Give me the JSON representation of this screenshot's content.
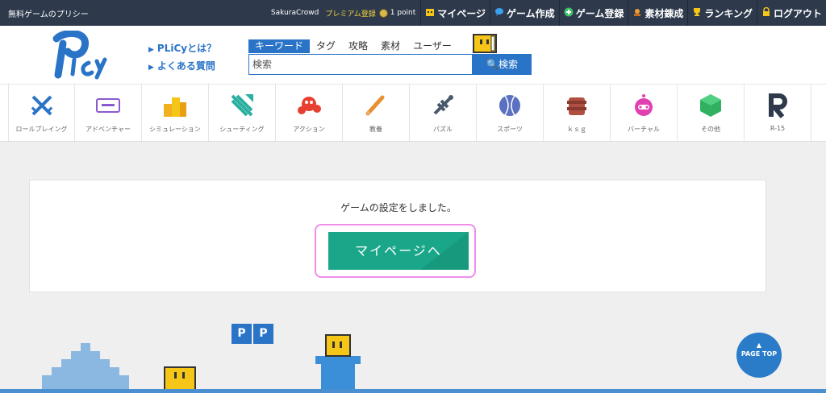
{
  "topbar": {
    "free_policy": "無料ゲームのプリシー",
    "username": "SakuraCrowd",
    "premium": "プレミアム登録",
    "points": "1 point",
    "nav": [
      {
        "label": "マイページ",
        "icon": "mypage-icon",
        "color": "#f5c518"
      },
      {
        "label": "ゲーム作成",
        "icon": "speech-bubble-icon",
        "color": "#3aa0f0"
      },
      {
        "label": "ゲーム登録",
        "icon": "plus-circle-icon",
        "color": "#3ec06a"
      },
      {
        "label": "素材錬成",
        "icon": "craft-icon",
        "color": "#f0a030"
      },
      {
        "label": "ランキング",
        "icon": "trophy-icon",
        "color": "#f5c518"
      },
      {
        "label": "ログアウト",
        "icon": "lock-icon",
        "color": "#f5c518"
      }
    ]
  },
  "header": {
    "links": [
      "PLiCyとは？",
      "よくある質問"
    ],
    "tabs": [
      "キーワード",
      "タグ",
      "攻略",
      "素材",
      "ユーザー"
    ],
    "search_placeholder": "検索",
    "search_button": "検索"
  },
  "categories": [
    {
      "label": "ロールプレイング",
      "icon": "crossed-swords-icon",
      "color": "#2a74c8"
    },
    {
      "label": "アドベンチャー",
      "icon": "ticket-icon",
      "color": "#8a5ad0"
    },
    {
      "label": "シミュレーション",
      "icon": "buildings-icon",
      "color": "#f0b020"
    },
    {
      "label": "シューティング",
      "icon": "jet-icon",
      "color": "#2ab0a0"
    },
    {
      "label": "アクション",
      "icon": "action-blob-icon",
      "color": "#e84030"
    },
    {
      "label": "教養",
      "icon": "pencil-icon",
      "color": "#e89030"
    },
    {
      "label": "パズル",
      "icon": "puzzle-icon",
      "color": "#4a5a6a"
    },
    {
      "label": "スポーツ",
      "icon": "ball-icon",
      "color": "#5a70c0"
    },
    {
      "label": "ｋｓｇ",
      "icon": "ksg-icon",
      "color": "#b05040"
    },
    {
      "label": "バーチャル",
      "icon": "robot-icon",
      "color": "#e040b0"
    },
    {
      "label": "その他",
      "icon": "gem-icon",
      "color": "#30b060"
    },
    {
      "label": "R-15",
      "icon": "r-letter-icon",
      "color": "#2e3a4c"
    }
  ],
  "main": {
    "message": "ゲームの設定をしました。",
    "button_label": "マイページへ"
  },
  "footer": {
    "pp_blocks": [
      "P",
      "P"
    ],
    "page_top_label": "PAGE TOP"
  }
}
